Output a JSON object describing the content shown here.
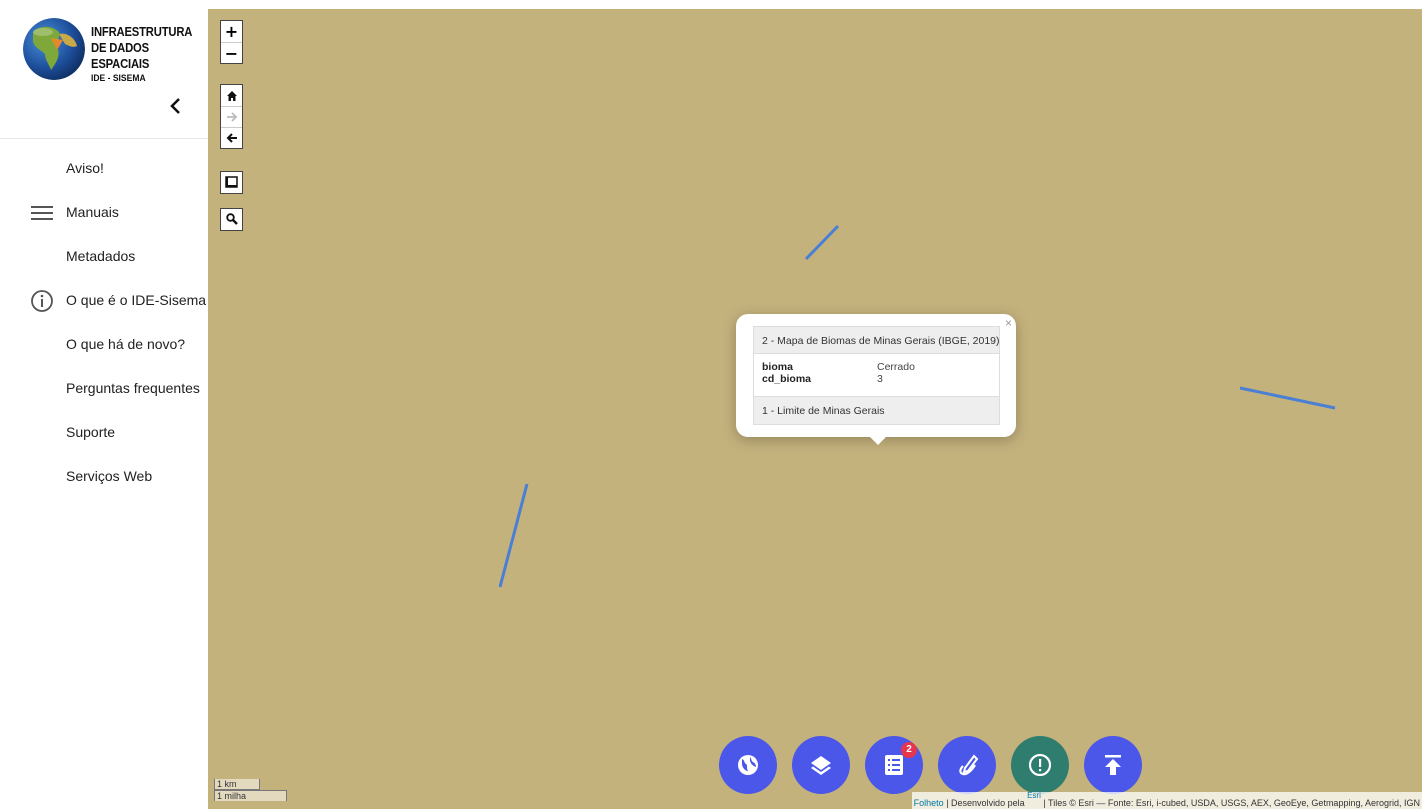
{
  "brand": {
    "line1": "INFRAESTRUTURA",
    "line2": "DE DADOS ESPACIAIS",
    "line3": "IDE - SISEMA"
  },
  "menu": [
    {
      "label": "Aviso!",
      "icon": null
    },
    {
      "label": "Manuais",
      "icon": "hamburger-icon"
    },
    {
      "label": "Metadados",
      "icon": null
    },
    {
      "label": "O que é o IDE-Sisema",
      "icon": "info-icon"
    },
    {
      "label": "O que há de novo?",
      "icon": null
    },
    {
      "label": "Perguntas frequentes",
      "icon": null
    },
    {
      "label": "Suporte",
      "icon": null
    },
    {
      "label": "Serviços Web",
      "icon": null
    }
  ],
  "map_controls": {
    "zoom_in": "+",
    "zoom_out": "−"
  },
  "popup": {
    "close": "×",
    "layer_title": "2 - Mapa de Biomas de Minas Gerais (IBGE, 2019)",
    "attributes": [
      {
        "key": "bioma",
        "value": "Cerrado"
      },
      {
        "key": "cd_bioma",
        "value": "3"
      }
    ],
    "other_layer": "1 - Limite de Minas Gerais"
  },
  "fab_buttons": [
    {
      "icon": "globe-icon",
      "color": "#4b57e9"
    },
    {
      "icon": "layers-icon",
      "color": "#4b57e9"
    },
    {
      "icon": "list-icon",
      "color": "#4b57e9",
      "badge": "2"
    },
    {
      "icon": "draw-icon",
      "color": "#4b57e9"
    },
    {
      "icon": "alert-icon",
      "color": "#2e7d6e"
    },
    {
      "icon": "upload-icon",
      "color": "#4b57e9"
    }
  ],
  "scale": {
    "metric": "1 km",
    "imperial": "1 milha"
  },
  "attribution": {
    "leaflet": "Folheto",
    "developed": " | Desenvolvido pela ",
    "esri": "Esri",
    "tiles": " | Tiles © Esri — Fonte: Esri, i-cubed, USDA, USGS, AEX, GeoEye, Getmapping, Aerogrid, IGN"
  },
  "colors": {
    "map_background": "#c4b27d",
    "boundary_line": "#4a7fd6",
    "fab_primary": "#4b57e9",
    "fab_alert": "#2e7d6e",
    "badge": "#e6354f"
  }
}
